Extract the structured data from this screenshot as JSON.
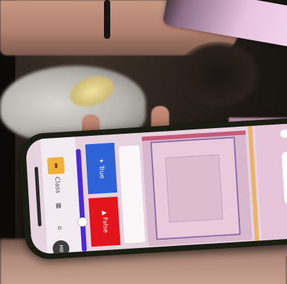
{
  "colors": {
    "true_button": "#2e63d8",
    "false_button": "#e3141b",
    "slider": "#4b2bd8",
    "screen_bg": "#e7d3df",
    "folder": "#f0b03a"
  },
  "icons": {
    "folder": "folder-icon",
    "home": "home-icon",
    "grid": "grid-icon",
    "user": "user-icon",
    "menu": "menu-icon"
  },
  "toolbar": {
    "label_1": "Class",
    "avatar_text": "MB"
  },
  "quiz": {
    "true_label": "✦ True",
    "false_label": "▲ False",
    "statement": ""
  },
  "slider": {
    "level": 0.73
  },
  "right_panel": {
    "button_label": ""
  }
}
